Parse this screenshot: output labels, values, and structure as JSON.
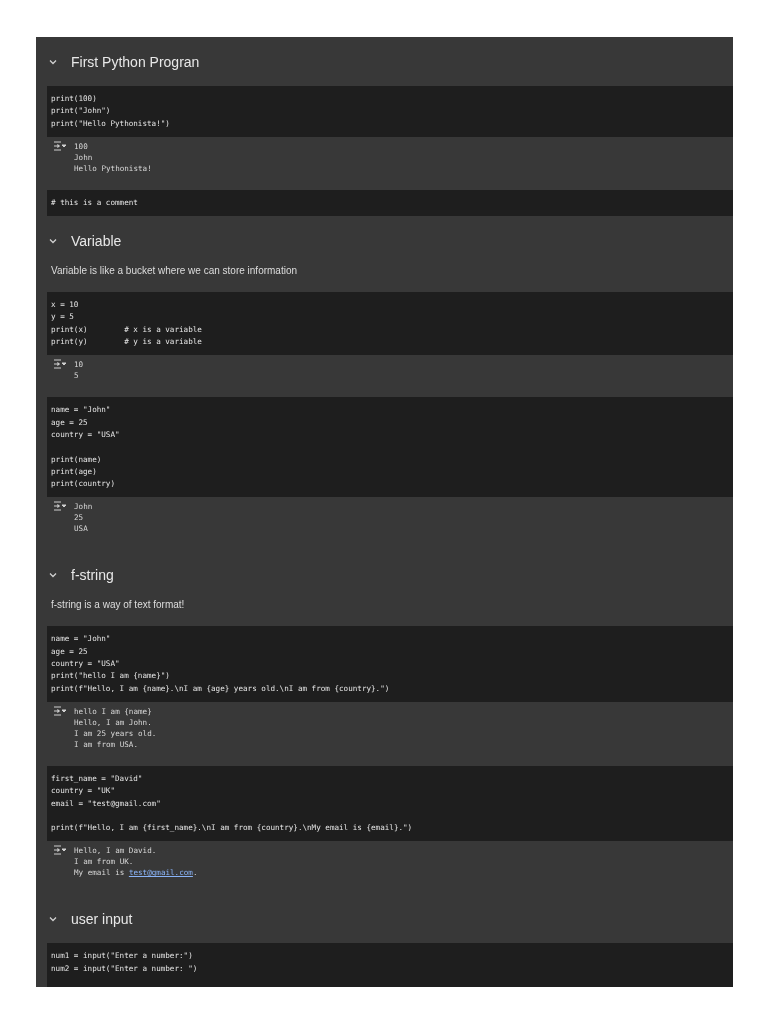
{
  "cells": [
    {
      "kind": "heading",
      "text": "First Python Progran",
      "expanded": true
    },
    {
      "kind": "code",
      "source": "print(100)\nprint(\"John\")\nprint(\"Hello Pythonista!\")"
    },
    {
      "kind": "output",
      "lines": [
        {
          "text": "100"
        },
        {
          "text": "John"
        },
        {
          "text": "Hello Pythonista!"
        }
      ]
    },
    {
      "kind": "code",
      "source": "# this is a comment"
    },
    {
      "kind": "heading",
      "text": "Variable",
      "expanded": true
    },
    {
      "kind": "text",
      "text": "Variable is like a bucket where we can store information"
    },
    {
      "kind": "code",
      "source": "x = 10\ny = 5\nprint(x)        # x is a variable\nprint(y)        # y is a variable"
    },
    {
      "kind": "output",
      "lines": [
        {
          "text": "10"
        },
        {
          "text": "5"
        }
      ]
    },
    {
      "kind": "code",
      "source": "name = \"John\"\nage = 25\ncountry = \"USA\"\n\nprint(name)\nprint(age)\nprint(country)"
    },
    {
      "kind": "output",
      "lines": [
        {
          "text": "John"
        },
        {
          "text": "25"
        },
        {
          "text": "USA"
        }
      ]
    },
    {
      "kind": "heading",
      "text": "f-string",
      "expanded": true
    },
    {
      "kind": "text",
      "text": "f-string is a way of text format!"
    },
    {
      "kind": "code",
      "source": "name = \"John\"\nage = 25\ncountry = \"USA\"\nprint(\"hello I am {name}\")\nprint(f\"Hello, I am {name}.\\nI am {age} years old.\\nI am from {country}.\")"
    },
    {
      "kind": "output",
      "lines": [
        {
          "text": "hello I am {name}"
        },
        {
          "text": "Hello, I am John."
        },
        {
          "text": "I am 25 years old."
        },
        {
          "text": "I am from USA."
        }
      ]
    },
    {
      "kind": "code",
      "source": "first_name = \"David\"\ncountry = \"UK\"\nemail = \"test@gmail.com\"\n\nprint(f\"Hello, I am {first_name}.\\nI am from {country}.\\nMy email is {email}.\")"
    },
    {
      "kind": "output",
      "lines": [
        {
          "text": "Hello, I am David."
        },
        {
          "text": "I am from UK."
        },
        {
          "text": "My email is ",
          "link": "test@gmail.com",
          "tail": "."
        }
      ]
    },
    {
      "kind": "heading",
      "text": "user input",
      "expanded": true
    },
    {
      "kind": "code",
      "source": "num1 = input(\"Enter a number:\")\nnum2 = input(\"Enter a number: \")\n "
    }
  ]
}
